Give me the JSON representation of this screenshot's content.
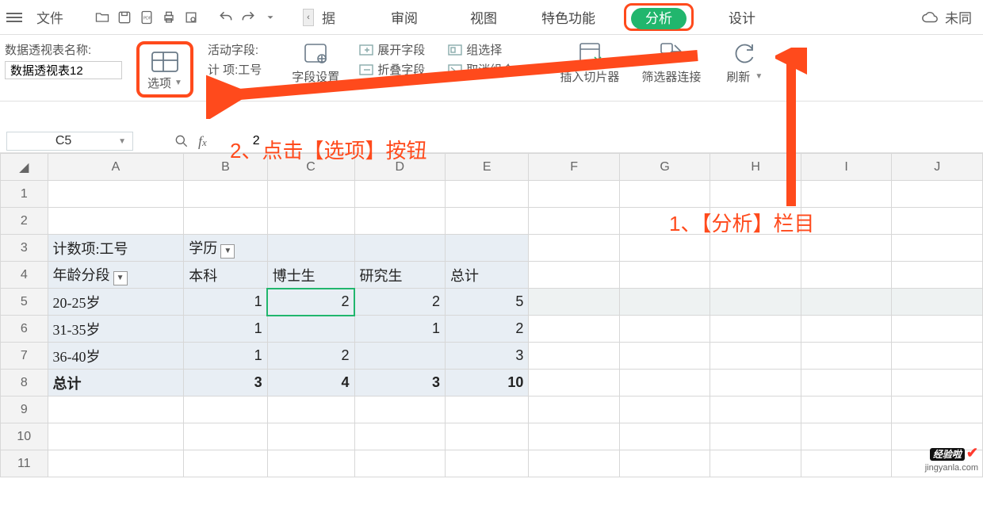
{
  "toolbar": {
    "file": "文件",
    "data_suffix": "据",
    "tabs": {
      "review": "审阅",
      "view": "视图",
      "special": "特色功能",
      "analysis": "分析",
      "design": "设计",
      "sync": "未同"
    }
  },
  "ribbon": {
    "pivot_name_label": "数据透视表名称:",
    "pivot_name_value": "数据透视表12",
    "options_label": "选项",
    "active_field_label": "活动字段:",
    "active_field_partial": "计    项:工号",
    "field_settings": "字段设置",
    "expand_field": "展开字段",
    "collapse_field": "折叠字段",
    "group_select": "组选择",
    "ungroup": "取消组合",
    "insert_slicer": "插入切片器",
    "filter_connections": "筛选器连接",
    "refresh": "刷新"
  },
  "annotations": {
    "step2": "2、点击【选项】按钮",
    "step1": "1、【分析】栏目"
  },
  "name_box": {
    "cell": "C5",
    "formula_value": "2"
  },
  "columns": [
    "A",
    "B",
    "C",
    "D",
    "E",
    "F",
    "G",
    "H",
    "I",
    "J"
  ],
  "row_numbers": [
    "1",
    "2",
    "3",
    "4",
    "5",
    "6",
    "7",
    "8",
    "9",
    "10",
    "11"
  ],
  "pivot": {
    "r3": {
      "a": "计数项:工号",
      "b": "学历"
    },
    "r4": {
      "a": "年龄分段",
      "b": "本科",
      "c": "博士生",
      "d": "研究生",
      "e": "总计"
    },
    "r5": {
      "a": "20-25岁",
      "b": "1",
      "c": "2",
      "d": "2",
      "e": "5"
    },
    "r6": {
      "a": "31-35岁",
      "b": "1",
      "c": "",
      "d": "1",
      "e": "2"
    },
    "r7": {
      "a": "36-40岁",
      "b": "1",
      "c": "2",
      "d": "",
      "e": "3"
    },
    "r8": {
      "a": "总计",
      "b": "3",
      "c": "4",
      "d": "3",
      "e": "10"
    }
  },
  "watermark": {
    "brand": "经验啦",
    "url": "jingyanla.com"
  }
}
